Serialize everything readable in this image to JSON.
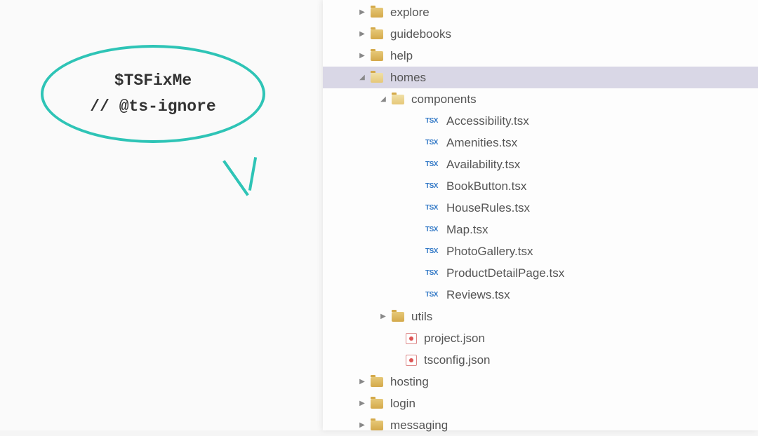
{
  "bubble": {
    "line1": "$TSFixMe",
    "line2": "// @ts-ignore"
  },
  "tree": [
    {
      "type": "folder",
      "label": "explore",
      "indent": 0,
      "expanded": false,
      "selected": false
    },
    {
      "type": "folder",
      "label": "guidebooks",
      "indent": 0,
      "expanded": false,
      "selected": false
    },
    {
      "type": "folder",
      "label": "help",
      "indent": 0,
      "expanded": false,
      "selected": false
    },
    {
      "type": "folder",
      "label": "homes",
      "indent": 0,
      "expanded": true,
      "selected": true
    },
    {
      "type": "folder",
      "label": "components",
      "indent": 1,
      "expanded": true,
      "selected": false
    },
    {
      "type": "tsx",
      "label": "Accessibility.tsx",
      "indent": 2
    },
    {
      "type": "tsx",
      "label": "Amenities.tsx",
      "indent": 2
    },
    {
      "type": "tsx",
      "label": "Availability.tsx",
      "indent": 2
    },
    {
      "type": "tsx",
      "label": "BookButton.tsx",
      "indent": 2
    },
    {
      "type": "tsx",
      "label": "HouseRules.tsx",
      "indent": 2
    },
    {
      "type": "tsx",
      "label": "Map.tsx",
      "indent": 2
    },
    {
      "type": "tsx",
      "label": "PhotoGallery.tsx",
      "indent": 2
    },
    {
      "type": "tsx",
      "label": "ProductDetailPage.tsx",
      "indent": 2
    },
    {
      "type": "tsx",
      "label": "Reviews.tsx",
      "indent": 2
    },
    {
      "type": "folder",
      "label": "utils",
      "indent": 1,
      "expanded": false,
      "selected": false
    },
    {
      "type": "json",
      "label": "project.json",
      "indent": 1
    },
    {
      "type": "json",
      "label": "tsconfig.json",
      "indent": 1
    },
    {
      "type": "folder",
      "label": "hosting",
      "indent": 0,
      "expanded": false,
      "selected": false
    },
    {
      "type": "folder",
      "label": "login",
      "indent": 0,
      "expanded": false,
      "selected": false
    },
    {
      "type": "folder",
      "label": "messaging",
      "indent": 0,
      "expanded": false,
      "selected": false
    }
  ]
}
